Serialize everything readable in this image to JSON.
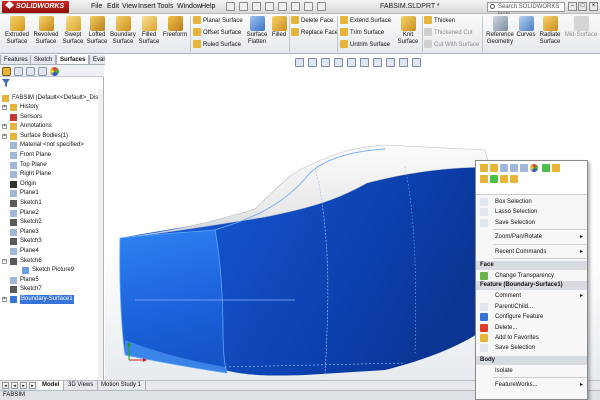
{
  "app": {
    "logo": "SOLIDWORKS",
    "doc_title": "FABSIM.SLDPRT *",
    "help_search_placeholder": "Search SOLIDWORKS Help"
  },
  "menu": [
    "File",
    "Edit",
    "View",
    "Insert",
    "Tools",
    "Window",
    "Help"
  ],
  "ribbon": {
    "big_buttons": [
      {
        "label1": "Extruded",
        "label2": "Surface"
      },
      {
        "label1": "Revolved",
        "label2": "Surface"
      },
      {
        "label1": "Swept",
        "label2": "Surface"
      },
      {
        "label1": "Lofted",
        "label2": "Surface"
      },
      {
        "label1": "Boundary",
        "label2": "Surface"
      },
      {
        "label1": "Filled",
        "label2": "Surface"
      },
      {
        "label1": "Freeform",
        "label2": ""
      }
    ],
    "col1": [
      "Planar Surface",
      "Offset Surface",
      "Ruled Surface"
    ],
    "flatten": {
      "label1": "Surface",
      "label2": "Flatten"
    },
    "filled": "Filled",
    "col2": [
      "Delete Face",
      "Replace Face"
    ],
    "col3": [
      "Extend Surface",
      "Trim Surface",
      "Untrim Surface"
    ],
    "knit": {
      "label1": "Knit",
      "label2": "Surface"
    },
    "col4": [
      "Thicken",
      "Thickened Cut",
      "Cut With Surface"
    ],
    "ref_geom": {
      "label1": "Reference",
      "label2": "Geometry"
    },
    "curves": "Curves",
    "radiate": {
      "label1": "Radiate",
      "label2": "Surface"
    },
    "midsurface": "Mid-Surface"
  },
  "command_tabs": [
    "Features",
    "Sketch",
    "Surfaces",
    "Evaluate"
  ],
  "feature_tree": {
    "root": "FABSIM  (Default<<Default>_Displ",
    "items": [
      {
        "label": "History",
        "exp": "+"
      },
      {
        "label": "Sensors",
        "exp": ""
      },
      {
        "label": "Annotations",
        "exp": "+"
      },
      {
        "label": "Surface Bodies(1)",
        "exp": "+"
      },
      {
        "label": "Material <not specified>",
        "exp": ""
      },
      {
        "label": "Front Plane",
        "exp": ""
      },
      {
        "label": "Top Plane",
        "exp": ""
      },
      {
        "label": "Right Plane",
        "exp": ""
      },
      {
        "label": "Origin",
        "exp": ""
      },
      {
        "label": "Plane1",
        "exp": ""
      },
      {
        "label": "Sketch1",
        "exp": ""
      },
      {
        "label": "Plane2",
        "exp": ""
      },
      {
        "label": "Sketch2",
        "exp": ""
      },
      {
        "label": "Plane3",
        "exp": ""
      },
      {
        "label": "Sketch3",
        "exp": ""
      },
      {
        "label": "Plane4",
        "exp": ""
      },
      {
        "label": "Sketch6",
        "exp": "−"
      },
      {
        "label": "Sketch Picture9",
        "exp": ""
      },
      {
        "label": "Plane5",
        "exp": ""
      },
      {
        "label": "Sketch7",
        "exp": ""
      },
      {
        "label": "Boundary-Surface1",
        "exp": "+"
      }
    ]
  },
  "bottom_tabs": [
    "Model",
    "3D Views",
    "Motion Study 1"
  ],
  "status": "FABSIM",
  "context_menu": {
    "items_top": [
      {
        "label": "Box Selection",
        "arrow": ""
      },
      {
        "label": "Lasso Selection",
        "arrow": ""
      },
      {
        "label": "Save Selection",
        "arrow": ""
      },
      {
        "label": "Zoom/Pan/Rotate",
        "arrow": "▸"
      },
      {
        "label": "Recent Commands",
        "arrow": "▸"
      }
    ],
    "header_face": "Face",
    "face_items": [
      {
        "label": "Change Transparency"
      }
    ],
    "header_feature": "Feature (Boundary-Surface1)",
    "feature_items": [
      {
        "label": "Comment",
        "arrow": "▸"
      },
      {
        "label": "Parent/Child...",
        "arrow": ""
      },
      {
        "label": "Configure Feature",
        "arrow": ""
      },
      {
        "label": "Delete...",
        "arrow": ""
      },
      {
        "label": "Add to Favorites",
        "arrow": ""
      },
      {
        "label": "Save Selection",
        "arrow": ""
      }
    ],
    "header_body": "Body",
    "body_items": [
      {
        "label": "Isolate",
        "arrow": ""
      },
      {
        "label": "FeatureWorks...",
        "arrow": "▸"
      }
    ]
  },
  "colors": {
    "model_blue": "#1b5fd8",
    "model_white": "#f3f3f3",
    "selection": "#3874d8",
    "logo_red": "#b8201b"
  }
}
